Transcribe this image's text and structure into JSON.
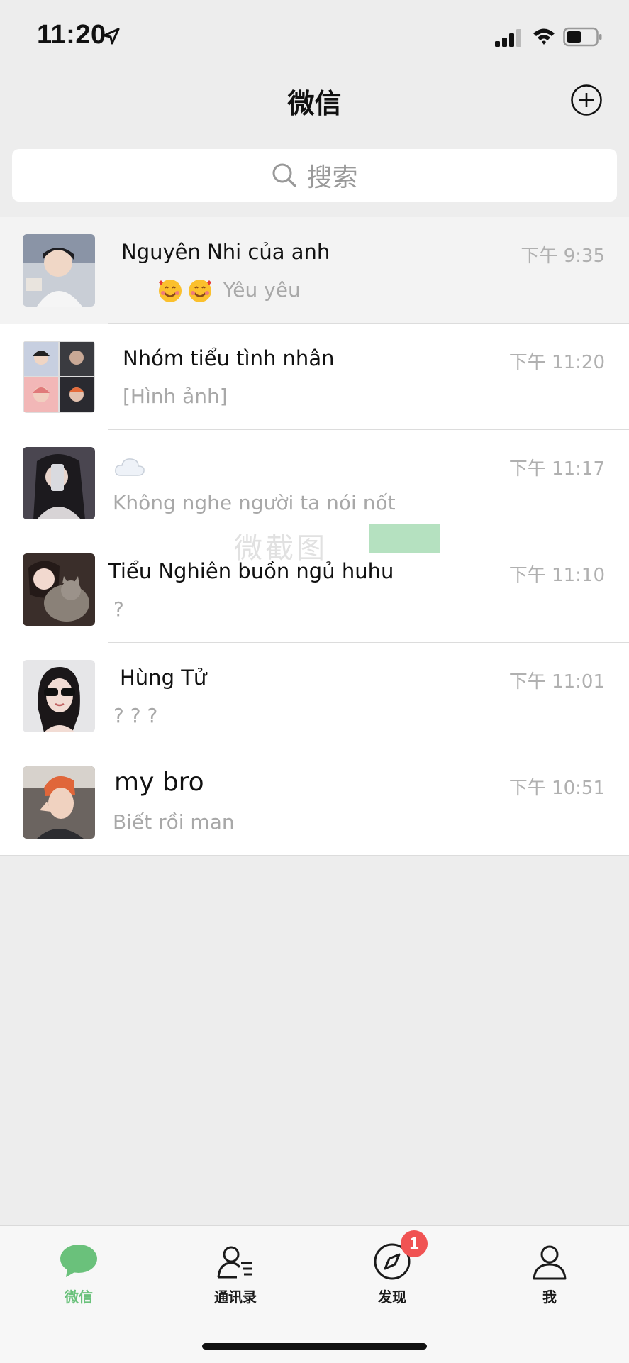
{
  "status": {
    "time": "11:20"
  },
  "header": {
    "title": "微信"
  },
  "search": {
    "placeholder": "搜索"
  },
  "chats": [
    {
      "name": "Nguyên Nhi của anh",
      "time": "下午 9:35",
      "preview": "Yêu yêu",
      "preview_emoji": "smiling-face-with-hearts",
      "pinned": true
    },
    {
      "name": "Nhóm tiểu tình nhân",
      "time": "下午 11:20",
      "preview": "[Hình ảnh]"
    },
    {
      "name": "",
      "name_icon": "cloud-icon",
      "time": "下午 11:17",
      "preview": "Không nghe người ta nói nốt"
    },
    {
      "name": "Tiểu Nghiên buồn ngủ huhu",
      "time": "下午 11:10",
      "preview": "?"
    },
    {
      "name": "Hùng Tử",
      "time": "下午 11:01",
      "preview": "? ? ?"
    },
    {
      "name": "my bro",
      "time": "下午 10:51",
      "preview": "Biết rồi man"
    }
  ],
  "watermark": {
    "text": "微截图"
  },
  "tabs": [
    {
      "label": "微信",
      "icon": "chat-bubble-icon",
      "active": true
    },
    {
      "label": "通讯录",
      "icon": "contacts-icon"
    },
    {
      "label": "发现",
      "icon": "compass-icon",
      "badge": "1"
    },
    {
      "label": "我",
      "icon": "person-icon"
    }
  ],
  "colors": {
    "accent": "#6ac17b",
    "badge": "#f05353",
    "background": "#ededed"
  }
}
